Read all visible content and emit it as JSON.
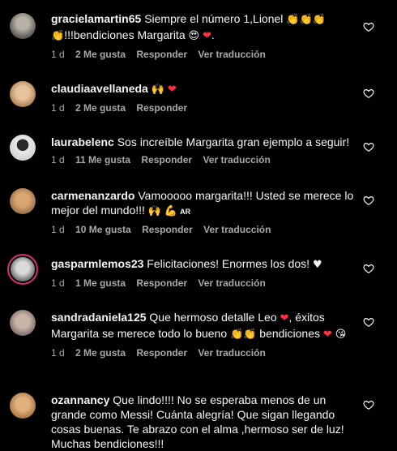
{
  "labels": {
    "likes_suffix": "Me gusta",
    "reply": "Responder",
    "translate": "Ver traducción"
  },
  "emoji": {
    "clap": "👏",
    "raised_hands": "🙌",
    "heart": "❤",
    "star_eyes": "😍",
    "muscle": "💪",
    "kiss": "😘",
    "white_heart": "♥",
    "flag": "AR"
  },
  "comments": [
    {
      "user": "gracielamartin65",
      "text_a": "Siempre el número 1,Lionel",
      "text_b": "!!!bendiciones Margarita",
      "text_c": ".",
      "time": "1 d",
      "likes": "2 Me gusta",
      "reply": "Responder",
      "translate": "Ver traducción"
    },
    {
      "user": "claudiaavellaneda",
      "time": "1 d",
      "likes": "2 Me gusta",
      "reply": "Responder"
    },
    {
      "user": "laurabelenc",
      "text_a": "Sos increíble Margarita gran ejemplo a seguir!",
      "time": "1 d",
      "likes": "11 Me gusta",
      "reply": "Responder",
      "translate": "Ver traducción"
    },
    {
      "user": "carmenanzardo",
      "text_a": "Vamooooo margarita!!! Usted se merece lo mejor del mundo!!!",
      "time": "1 d",
      "likes": "10 Me gusta",
      "reply": "Responder",
      "translate": "Ver traducción"
    },
    {
      "user": "gasparmlemos23",
      "text_a": "Felicitaciones! Enormes los dos!",
      "time": "1 d",
      "likes": "1 Me gusta",
      "reply": "Responder",
      "translate": "Ver traducción"
    },
    {
      "user": "sandradaniela125",
      "text_a": "Que hermoso detalle Leo",
      "text_b": ", éxitos Margarita se merece todo lo bueno",
      "text_c": "bendiciones",
      "time": "1 d",
      "likes": "2 Me gusta",
      "reply": "Responder",
      "translate": "Ver traducción"
    },
    {
      "user": "ozannancy",
      "text_a": "Que lindo!!!! No se esperaba menos de un grande como Messi! Cuánta alegría! Que sigan llegando cosas buenas. Te abrazo con el alma ,hermoso ser de luz! Muchas bendiciones!!!"
    }
  ],
  "colors": {
    "background": "#000000",
    "text": "#f5f5f5",
    "meta": "#a8a8a8",
    "heart": "#ff3040",
    "story_ring": "#d62976"
  }
}
